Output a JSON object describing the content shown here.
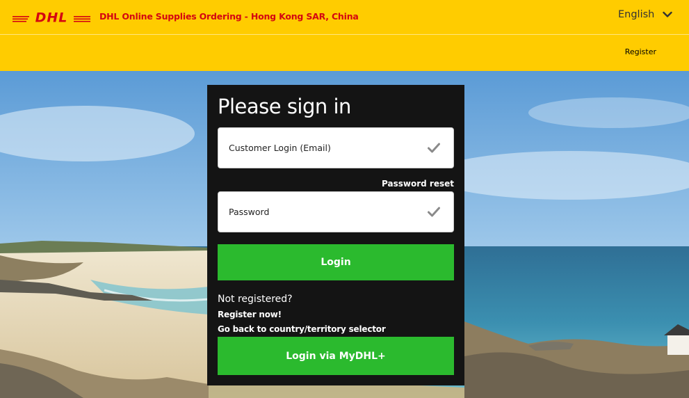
{
  "header": {
    "logo_text": "DHL",
    "site_title": "DHL Online Supplies Ordering - Hong Kong SAR, China",
    "language": "English",
    "register_label": "Register"
  },
  "login": {
    "title": "Please sign in",
    "email_placeholder": "Customer Login (Email)",
    "email_value": "",
    "password_reset_label": "Password reset",
    "password_placeholder": "Password",
    "password_value": "",
    "login_button": "Login",
    "not_registered_text": "Not registered?",
    "register_now_label": "Register now!",
    "country_selector_label": "Go back to country/territory selector",
    "mydhl_button": "Login via MyDHL+"
  },
  "icons": {
    "language_chevron": "chevron-down-icon",
    "field_check": "check-icon"
  },
  "colors": {
    "brand_yellow": "#ffcc00",
    "brand_red": "#d40511",
    "panel_bg": "#141414",
    "button_green": "#2bba2e"
  }
}
